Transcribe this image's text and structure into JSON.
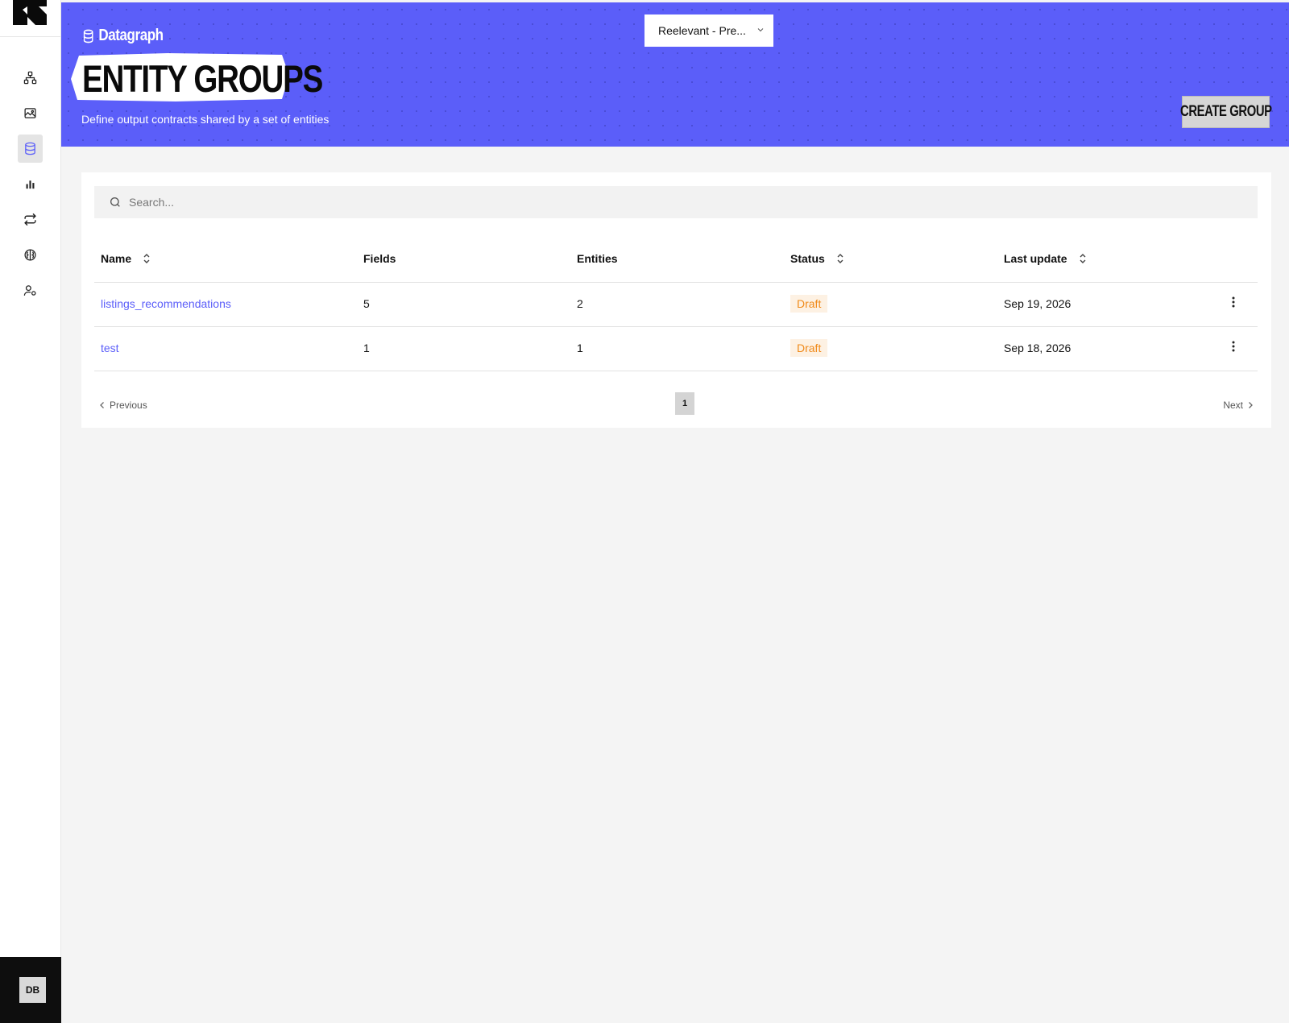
{
  "app": {
    "avatar_initials": "DB"
  },
  "header": {
    "breadcrumb": "Datagraph",
    "title": "ENTITY GROUPS",
    "subtitle": "Define output contracts shared by a set of entities",
    "project_select": "Reelevant - Pre...",
    "create_button": "CREATE GROUP",
    "accent_color": "#5b5ef9"
  },
  "sidebar": {
    "items": [
      {
        "icon": "network-icon"
      },
      {
        "icon": "image-chart-icon"
      },
      {
        "icon": "database-icon",
        "active": true
      },
      {
        "icon": "bar-chart-icon"
      },
      {
        "icon": "repeat-icon"
      },
      {
        "icon": "brain-icon"
      },
      {
        "icon": "user-settings-icon"
      }
    ]
  },
  "search": {
    "placeholder": "Search..."
  },
  "table": {
    "columns": [
      "Name",
      "Fields",
      "Entities",
      "Status",
      "Last update"
    ],
    "rows": [
      {
        "name": "listings_recommendations",
        "fields": "5",
        "entities": "2",
        "status": "Draft",
        "last_update": "Sep 19, 2026"
      },
      {
        "name": "test",
        "fields": "1",
        "entities": "1",
        "status": "Draft",
        "last_update": "Sep 18, 2026"
      }
    ]
  },
  "pagination": {
    "previous": "Previous",
    "current_page": "1",
    "next": "Next"
  }
}
